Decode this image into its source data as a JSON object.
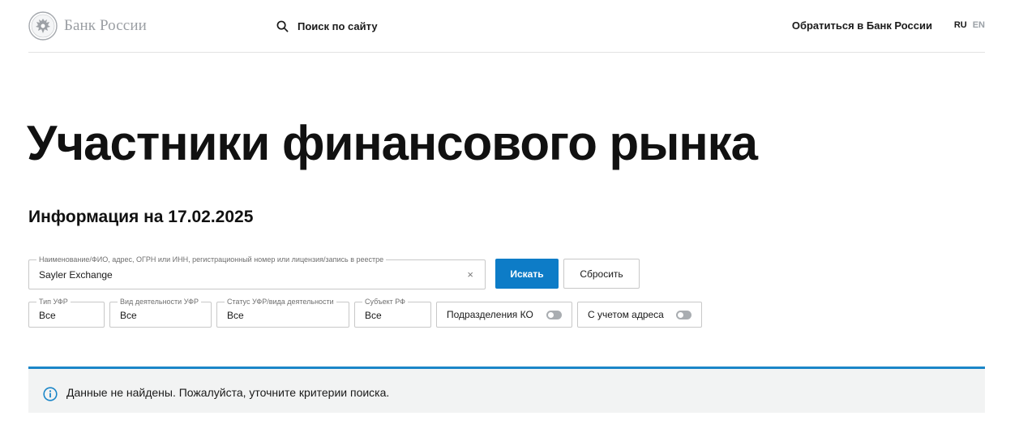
{
  "header": {
    "logo_text": "Банк России",
    "search_label": "Поиск по сайту",
    "contact_label": "Обратиться в Банк России",
    "lang_ru": "RU",
    "lang_en": "EN"
  },
  "page": {
    "title": "Участники финансового рынка",
    "info_date": "Информация на 17.02.2025"
  },
  "search": {
    "legend": "Наименование/ФИО, адрес, ОГРН или ИНН, регистрационный номер или лицензия/запись в реестре",
    "value": "Sayler Exchange",
    "clear_symbol": "×",
    "submit_label": "Искать",
    "reset_label": "Сбросить"
  },
  "filters": {
    "type": {
      "legend": "Тип УФР",
      "value": "Все"
    },
    "activity": {
      "legend": "Вид деятельности УФР",
      "value": "Все"
    },
    "status": {
      "legend": "Статус УФР/вида деятельности",
      "value": "Все"
    },
    "subject": {
      "legend": "Субъект РФ",
      "value": "Все"
    },
    "ko_toggle": {
      "label": "Подразделения КО",
      "on": false
    },
    "address_toggle": {
      "label": "С учетом адреса",
      "on": false
    }
  },
  "notice": {
    "text": "Данные не найдены. Пожалуйста, уточните критерии поиска.",
    "icon": "info-icon"
  },
  "colors": {
    "accent": "#0d7cc7",
    "notice_border": "#1b86c8",
    "notice_bg": "#f2f3f3",
    "logo_gray": "#9a9ea3"
  }
}
